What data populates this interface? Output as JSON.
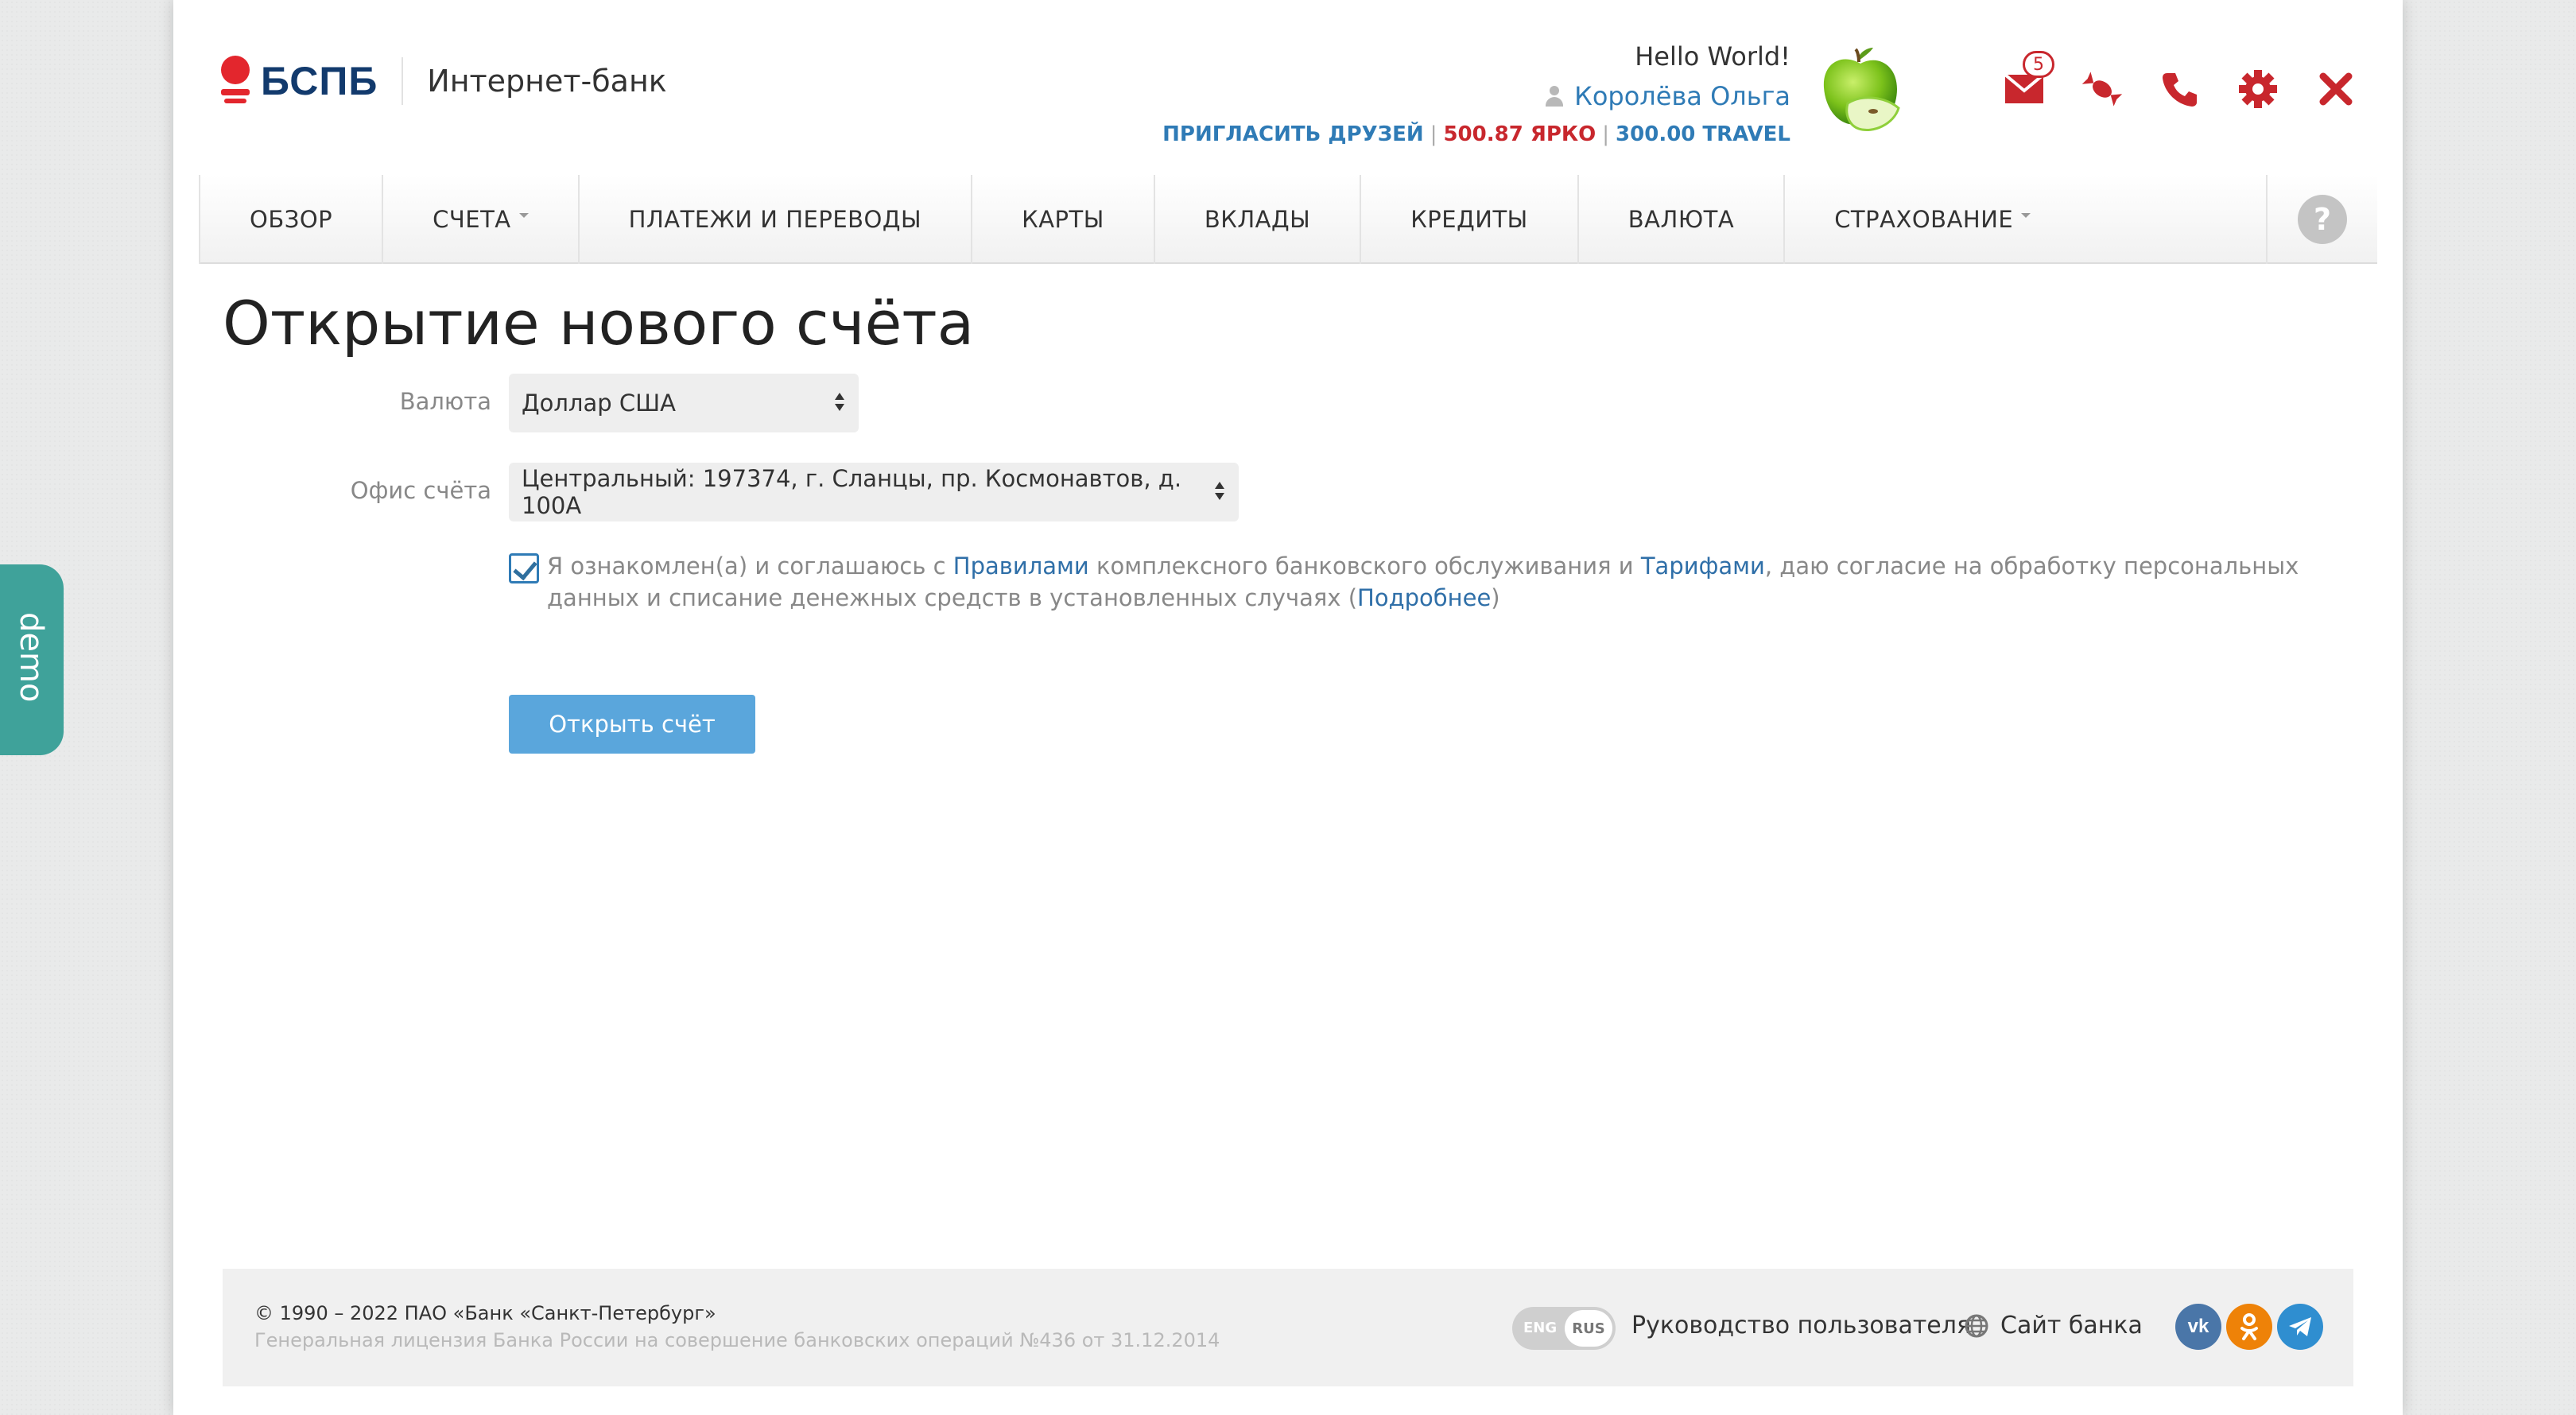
{
  "header": {
    "logo_text": "БСПБ",
    "logo_subtitle": "Интернет-банк",
    "greeting": "Hello World!",
    "user_name": "Королёва Ольга",
    "invite_label": "ПРИГЛАСИТЬ ДРУЗЕЙ",
    "bonus_yarko": "500.87 ЯРКО",
    "bonus_travel": "300.00 TRAVEL",
    "messages_count": "5",
    "icons": [
      "mail-icon",
      "candy-icon",
      "phone-icon",
      "gear-icon",
      "close-icon"
    ]
  },
  "nav": {
    "items": [
      {
        "label": "ОБЗОР",
        "dropdown": false
      },
      {
        "label": "СЧЕТА",
        "dropdown": true
      },
      {
        "label": "ПЛАТЕЖИ И ПЕРЕВОДЫ",
        "dropdown": false
      },
      {
        "label": "КАРТЫ",
        "dropdown": false
      },
      {
        "label": "ВКЛАДЫ",
        "dropdown": false
      },
      {
        "label": "КРЕДИТЫ",
        "dropdown": false
      },
      {
        "label": "ВАЛЮТА",
        "dropdown": false
      },
      {
        "label": "СТРАХОВАНИЕ",
        "dropdown": true
      }
    ],
    "help": "?"
  },
  "main": {
    "title": "Открытие нового счёта",
    "currency_label": "Валюта",
    "currency_value": "Доллар США",
    "office_label": "Офис счёта",
    "office_value": "Центральный: 197374, г. Сланцы, пр. Космонавтов, д. 100А",
    "agree": {
      "checked": true,
      "t1": "Я ознакомлен(а) и соглашаюсь с ",
      "link_rules": "Правилами",
      "t2": " комплексного банковского обслуживания и ",
      "link_tariffs": "Тарифами",
      "t3": ", даю согласие на обработку персональных данных и списание денежных средств в установленных случаях (",
      "link_more": "Подробнее",
      "t4": ")"
    },
    "submit_label": "Открыть счёт"
  },
  "footer": {
    "copyright": "© 1990 – 2022 ПАО «Банк «Санкт-Петербург»",
    "license": "Генеральная лицензия Банка России на совершение банковских операций №436 от 31.12.2014",
    "lang_eng": "ENG",
    "lang_rus": "RUS",
    "manual": "Руководство пользователя",
    "site": "Сайт банка",
    "socials": [
      "vk-icon",
      "odnoklassniki-icon",
      "telegram-icon"
    ]
  },
  "demo_tab": "demo",
  "colors": {
    "brand_red": "#e3262d",
    "brand_blue": "#123a6d",
    "link_blue": "#2f7bb6",
    "button_blue": "#5aa6dc",
    "demo_teal": "#3fa29a"
  }
}
